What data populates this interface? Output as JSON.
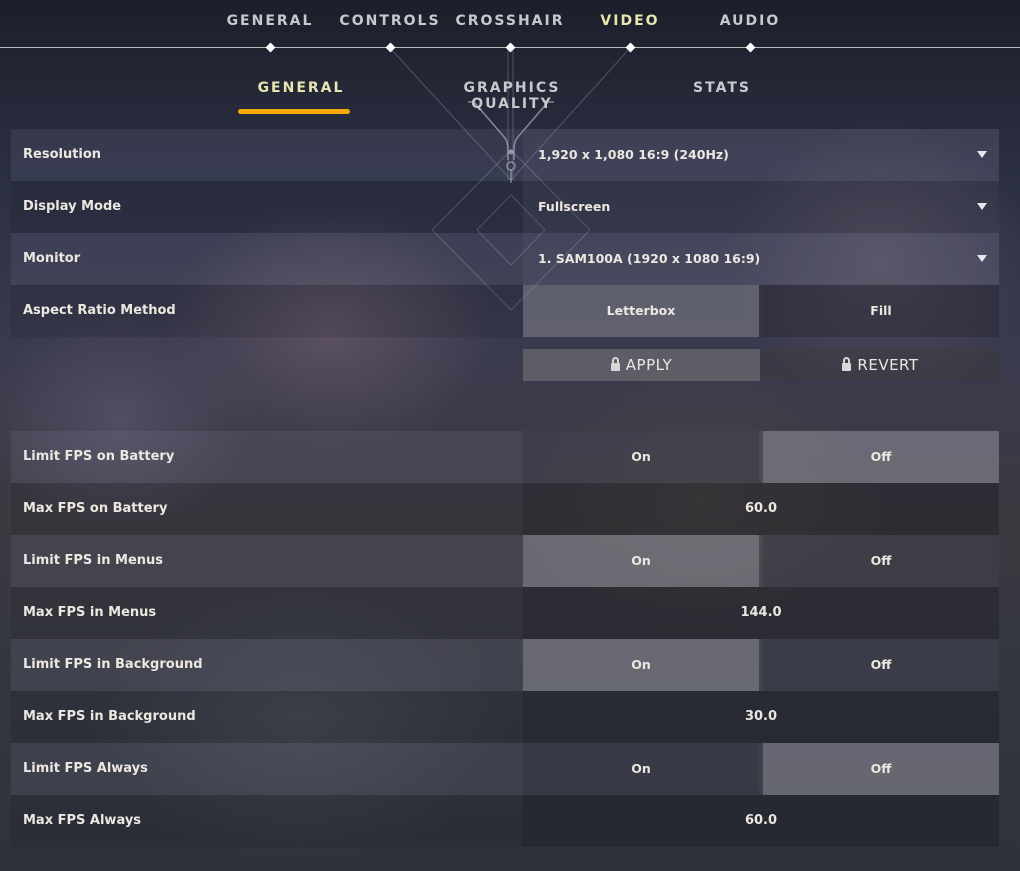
{
  "top_nav": {
    "items": [
      {
        "label": "GENERAL",
        "active": false
      },
      {
        "label": "CONTROLS",
        "active": false
      },
      {
        "label": "CROSSHAIR",
        "active": false
      },
      {
        "label": "VIDEO",
        "active": true
      },
      {
        "label": "AUDIO",
        "active": false
      }
    ]
  },
  "sub_tabs": {
    "items": [
      {
        "label": "GENERAL",
        "active": true
      },
      {
        "label": "GRAPHICS QUALITY",
        "active": false
      },
      {
        "label": "STATS",
        "active": false
      }
    ]
  },
  "colors": {
    "accent": "#f5a80a",
    "active_tab_text": "#e8e6b0",
    "text": "#ece8e1"
  },
  "settings": {
    "resolution": {
      "label": "Resolution",
      "value": "1,920 x 1,080 16:9 (240Hz)",
      "icon": "chevron-down-icon"
    },
    "display_mode": {
      "label": "Display Mode",
      "value": "Fullscreen",
      "icon": "chevron-down-icon"
    },
    "monitor": {
      "label": "Monitor",
      "value": "1. SAM100A (1920 x  1080 16:9)",
      "icon": "chevron-down-icon"
    },
    "aspect_ratio": {
      "label": "Aspect Ratio Method",
      "options": [
        "Letterbox",
        "Fill"
      ],
      "selected": "Letterbox"
    },
    "apply_label": "APPLY",
    "revert_label": "REVERT",
    "limit_fps_battery": {
      "label": "Limit FPS on Battery",
      "options": [
        "On",
        "Off"
      ],
      "selected": "Off"
    },
    "max_fps_battery": {
      "label": "Max FPS on Battery",
      "value": "60.0"
    },
    "limit_fps_menus": {
      "label": "Limit FPS in Menus",
      "options": [
        "On",
        "Off"
      ],
      "selected": "On"
    },
    "max_fps_menus": {
      "label": "Max FPS in Menus",
      "value": "144.0"
    },
    "limit_fps_background": {
      "label": "Limit FPS in Background",
      "options": [
        "On",
        "Off"
      ],
      "selected": "On"
    },
    "max_fps_background": {
      "label": "Max FPS in Background",
      "value": "30.0"
    },
    "limit_fps_always": {
      "label": "Limit FPS Always",
      "options": [
        "On",
        "Off"
      ],
      "selected": "Off"
    },
    "max_fps_always": {
      "label": "Max FPS Always",
      "value": "60.0"
    }
  }
}
